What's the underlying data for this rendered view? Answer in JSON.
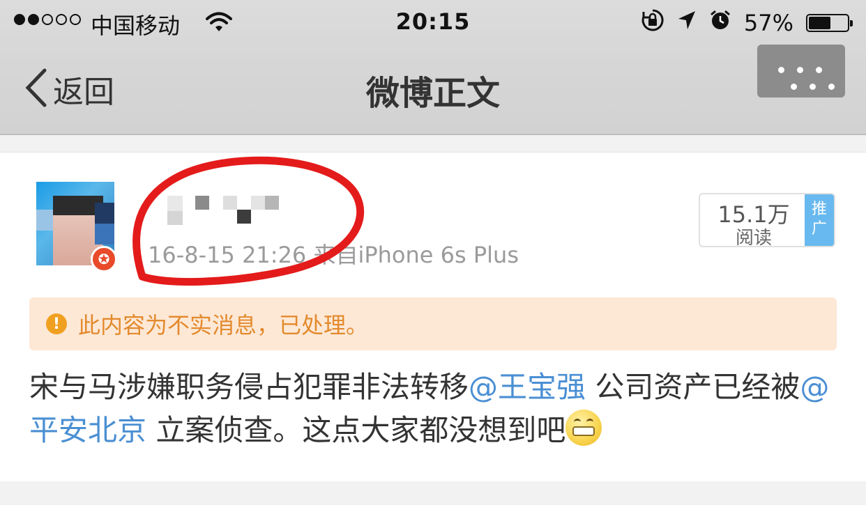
{
  "status_bar": {
    "carrier": "中国移动",
    "time": "20:15",
    "battery_pct": "57%",
    "battery_level": 0.57,
    "signal_bars_filled": 2,
    "signal_bars_total": 5
  },
  "nav": {
    "back_label": "返回",
    "title": "微博正文"
  },
  "post": {
    "timestamp": "16-8-15 21:26",
    "source": "来自iPhone 6s Plus",
    "read_count": "15.1万",
    "read_label": "阅读",
    "promote_label": "推广",
    "warning": "此内容为不实消息，已处理。",
    "text_part1": "宋与马涉嫌职务侵占犯罪非法转移",
    "mention1": "@王宝强",
    "text_part2": " 公司资产已经被",
    "mention2": "@平安北京",
    "text_part3": " 立案侦查。这点大家都没想到吧"
  },
  "colors": {
    "mention": "#4a8fd3",
    "warning_bg": "#fde8d6",
    "warning_text": "#e38a2d",
    "promote_bg": "#68b9ef",
    "annotation_red": "#e41b1b"
  },
  "icons": [
    "back-chevron-icon",
    "more-icon",
    "wifi-icon",
    "orientation-lock-icon",
    "location-icon",
    "alarm-icon",
    "battery-icon",
    "verified-badge-icon",
    "warning-icon",
    "grin-emoji-icon"
  ]
}
